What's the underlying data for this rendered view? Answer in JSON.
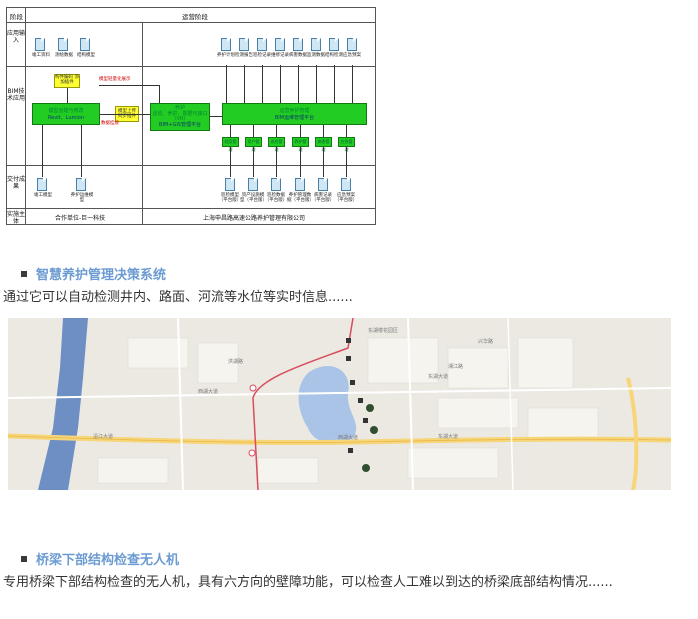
{
  "diagram": {
    "header_left": "阶段",
    "header_right": "运营阶段",
    "row_labels": [
      "应用输入",
      "BIM技术应用",
      "交付成果",
      "实施主体"
    ],
    "inputs_left": [
      "竣工资料",
      "测绘数据",
      "结构模型"
    ],
    "inputs_right": [
      "养护计划",
      "检测报告",
      "巡检记录",
      "维修记录",
      "病害数据",
      "监测数据",
      "结构检测",
      "应急预案"
    ],
    "yellow_top": "构件编码\n添加插件",
    "yellow_mid": "模型上传\n同步插件",
    "red_top": "模型轻量化展示",
    "red_mid": "数据挂接",
    "green_left_title": "模型创建与修改",
    "green_left_sub": "Revit、Lumion",
    "green_center_title": "养护\n巡检、养护、数据与接口（VR）",
    "green_center_sub": "BIM+GIS管理平台",
    "green_right_title": "运营养护管理",
    "green_right_sub": "BIM运维管理平台",
    "modules": [
      "档案管理",
      "资产管理",
      "巡检管理",
      "养护管理",
      "病害管理",
      "应急管理"
    ],
    "outputs_left": [
      "竣工模型",
      "养护运维模型"
    ],
    "outputs_right": [
      "巡检模型（平台版）",
      "资产设施模型（平台版）",
      "巡检数据（平台版）",
      "养护管理数据（平台版）",
      "病害记录（平台版）",
      "应急预案（平台版）"
    ],
    "footer_left": "合作单位-巨一科技",
    "footer_right": "上海申昌路高速公路养护管理有限公司"
  },
  "section1": {
    "title": "智慧养护管理决策系统",
    "text": "通过它可以自动检测井内、路面、河流等水位等实时信息......"
  },
  "map": {
    "labels": [
      "东湖楼花园区",
      "西湖大道",
      "东湖大道",
      "兴华路",
      "湘江路",
      "西湖大道",
      "东湖大道",
      "洪湖路",
      "沿江大道"
    ]
  },
  "section2": {
    "title": "桥梁下部结构检查无人机",
    "text": "专用桥梁下部结构检查的无人机，具有六方向的壁障功能，可以检查人工难以到达的桥梁底部结构情况......"
  },
  "colors": {
    "title_blue": "#6b9bd2",
    "box_green": "#22cc22",
    "box_yellow": "#ffff33",
    "river_blue": "#6e8fc4",
    "road_yellow": "#f7d67a"
  }
}
